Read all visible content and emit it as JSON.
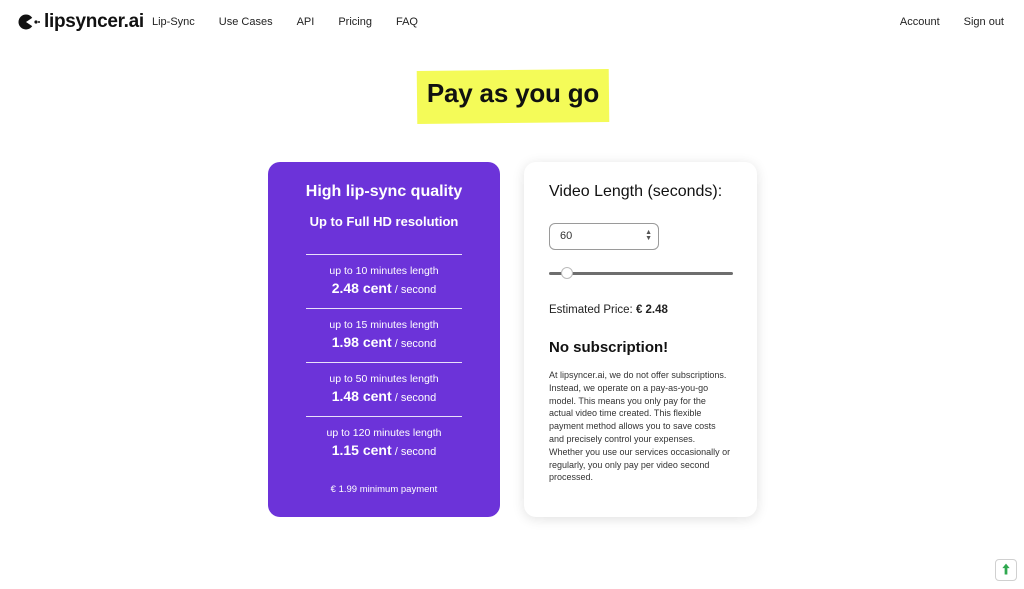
{
  "brand": {
    "name": "lipsyncer.ai"
  },
  "nav": {
    "links": [
      "Lip-Sync",
      "Use Cases",
      "API",
      "Pricing",
      "FAQ"
    ],
    "account": "Account",
    "signout": "Sign out"
  },
  "hero": {
    "title": "Pay as you go"
  },
  "plan": {
    "title": "High lip-sync quality",
    "subtitle": "Up to Full HD resolution",
    "tiers": [
      {
        "length": "up to 10 minutes length",
        "price": "2.48 cent",
        "unit": "/ second"
      },
      {
        "length": "up to 15 minutes length",
        "price": "1.98 cent",
        "unit": "/ second"
      },
      {
        "length": "up to 50 minutes length",
        "price": "1.48 cent",
        "unit": "/ second"
      },
      {
        "length": "up to 120 minutes length",
        "price": "1.15 cent",
        "unit": "/ second"
      }
    ],
    "minimum": "€ 1.99 minimum payment"
  },
  "calculator": {
    "title": "Video Length (seconds):",
    "input_value": "60",
    "slider_fraction": 0.07,
    "estimate_label": "Estimated Price:",
    "estimate_value": "€ 2.48",
    "nosub_title": "No subscription!",
    "nosub_text": "At lipsyncer.ai, we do not offer subscriptions. Instead, we operate on a pay-as-you-go model. This means you only pay for the actual video time created. This flexible payment method allows you to save costs and precisely control your expenses. Whether you use our services occasionally or regularly, you only pay per video second processed."
  },
  "colors": {
    "accent": "#6c33d9",
    "highlight": "#f4fb58",
    "scroll_icon": "#2fa84f"
  },
  "icons": {
    "logo": "lips-logo-icon",
    "scroll": "arrow-up-icon"
  }
}
